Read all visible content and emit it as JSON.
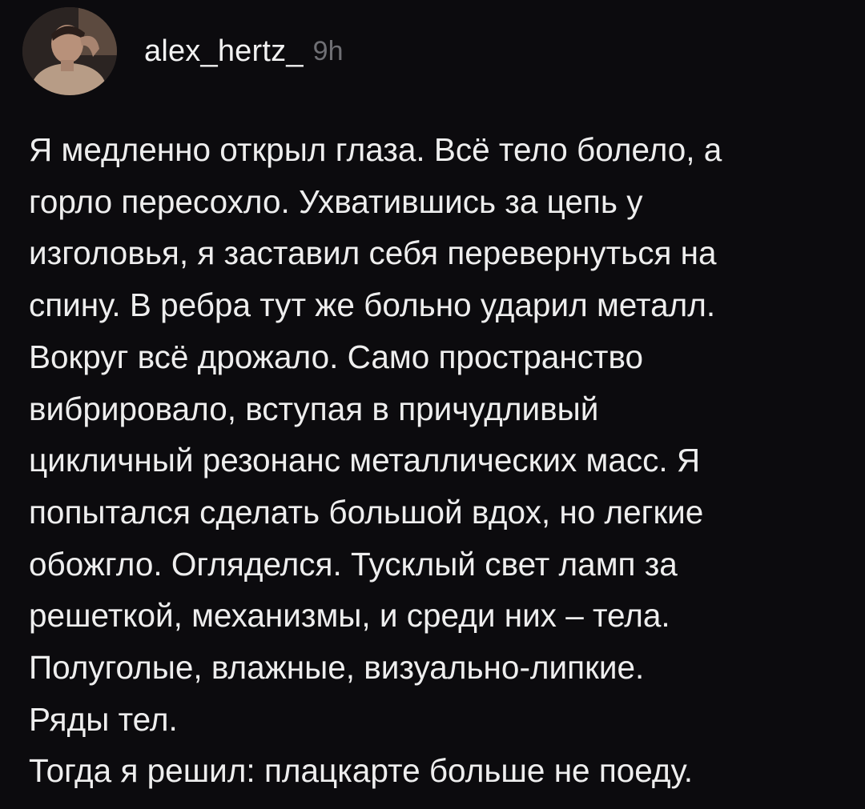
{
  "post": {
    "author": {
      "username": "alex_hertz_",
      "time": "9h"
    },
    "lines": [
      "Я медленно открыл глаза. Всё тело болело, а",
      "горло пересохло. Ухватившись за цепь у",
      "изголовья, я заставил себя перевернуться на",
      "спину. В ребра тут же больно ударил металл.",
      "Вокруг всё дрожало. Само пространство",
      "вибрировало, вступая в причудливый",
      "цикличный резонанс металлических масс. Я",
      "попытался сделать  большой вдох, но легкие",
      "обожгло. Огляделся. Тусклый свет ламп за",
      "решеткой, механизмы, и среди них – тела.",
      "Полуголые, влажные, визуально-липкие.",
      "Ряды тел.",
      "Тогда я решил: плацкарте больше не поеду."
    ]
  }
}
